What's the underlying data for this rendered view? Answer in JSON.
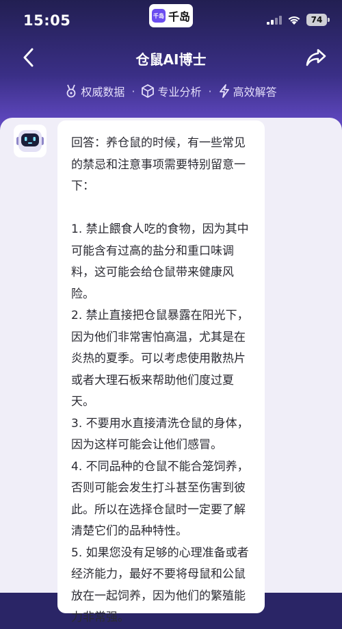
{
  "status_bar": {
    "time": "15:05",
    "app_badge_text": "千岛",
    "app_name": "千岛",
    "battery": "74"
  },
  "nav": {
    "title": "仓鼠AI博士",
    "back_icon": "chevron-left-icon",
    "share_icon": "share-arrow-icon"
  },
  "features": [
    {
      "label": "权威数据",
      "icon": "medal-icon"
    },
    {
      "label": "专业分析",
      "icon": "cube-icon"
    },
    {
      "label": "高效解答",
      "icon": "lightning-icon"
    }
  ],
  "separator": "·",
  "message": {
    "avatar_icon": "robot-avatar-icon",
    "text": "回答：养仓鼠的时候，有一些常见的禁忌和注意事项需要特别留意一下：\n\n1. 禁止餵食人吃的食物，因为其中可能含有过高的盐分和重口味调料，这可能会给仓鼠带来健康风险。\n2. 禁止直接把仓鼠暴露在阳光下，因为他们非常害怕高温，尤其是在炎热的夏季。可以考虑使用散热片或者大理石板来帮助他们度过夏天。\n3. 不要用水直接清洗仓鼠的身体，因为这样可能会让他们感冒。\n4. 不同品种的仓鼠不能合笼饲养，否则可能会发生打斗甚至伤害到彼此。所以在选择仓鼠时一定要了解清楚它们的品种特性。\n5. 如果您没有足够的心理准备或者经济能力，最好不要将母鼠和公鼠放在一起饲养，因为他们的繁殖能力非常强。"
  },
  "colors": {
    "accent": "#6b4df0",
    "header_top": "#221f52",
    "header_bottom": "#6a4fd0",
    "content_bg": "#f0eef8"
  }
}
